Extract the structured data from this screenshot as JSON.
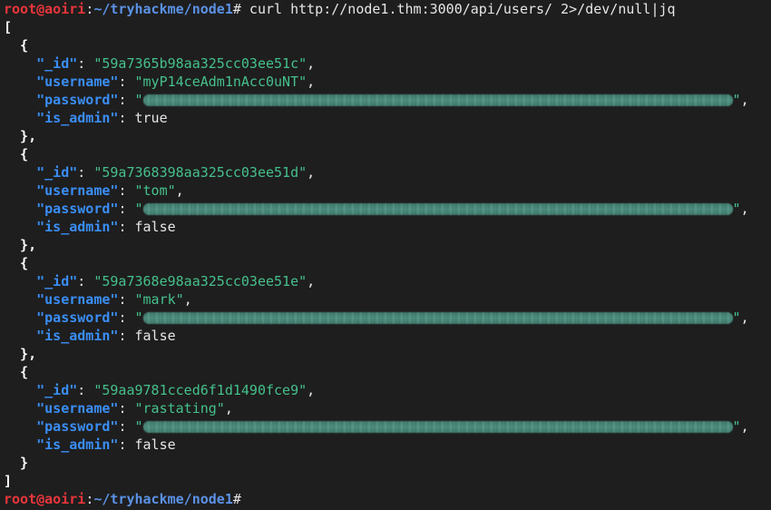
{
  "prompt": {
    "user_host": "root@aoiri",
    "separator": ":",
    "path": "~/tryhackme/node1",
    "symbol": "#"
  },
  "command": " curl http://node1.thm:3000/api/users/ 2>/dev/null|jq",
  "json_open": "[",
  "json_close": "]",
  "keys": {
    "id": "\"_id\"",
    "username": "\"username\"",
    "password": "\"password\"",
    "is_admin": "\"is_admin\""
  },
  "users": [
    {
      "id": "\"59a7365b98aa325cc03ee51c\"",
      "username": "\"myP14ceAdm1nAcc0uNT\"",
      "is_admin": "true"
    },
    {
      "id": "\"59a7368398aa325cc03ee51d\"",
      "username": "\"tom\"",
      "is_admin": "false"
    },
    {
      "id": "\"59a7368e98aa325cc03ee51e\"",
      "username": "\"mark\"",
      "is_admin": "false"
    },
    {
      "id": "\"59aa9781cced6f1d1490fce9\"",
      "username": "\"rastating\"",
      "is_admin": "false"
    }
  ]
}
